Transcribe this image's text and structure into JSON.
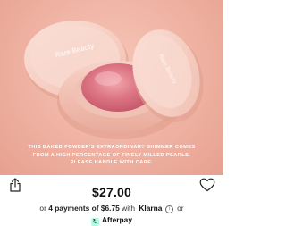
{
  "product": {
    "brand_lid_text": "Rare Beauty",
    "caption": "THIS BAKED POWDER'S EXTRAORDINARY SHIMMER COMES FROM A HIGH PERCENTAGE OF FINELY MILLED PEARLS. PLEASE HANDLE WITH CARE.",
    "price": "$27.00"
  },
  "payment": {
    "prefix": "or",
    "installments_text": "4 payments of $6.75",
    "with": "with",
    "klarna": "Klarna",
    "info_symbol": "i",
    "or_text": "or",
    "afterpay_badge": "↻",
    "afterpay": "Afterpay"
  },
  "icons": {
    "share": "share-icon",
    "wishlist": "heart-icon",
    "info": "info-icon",
    "afterpay": "afterpay-logo-icon"
  },
  "colors": {
    "hero_background": "#efb2a2",
    "compact": "#f4cdc3",
    "blush_pan": "#d76a78",
    "afterpay_mint": "#b2fce4"
  }
}
